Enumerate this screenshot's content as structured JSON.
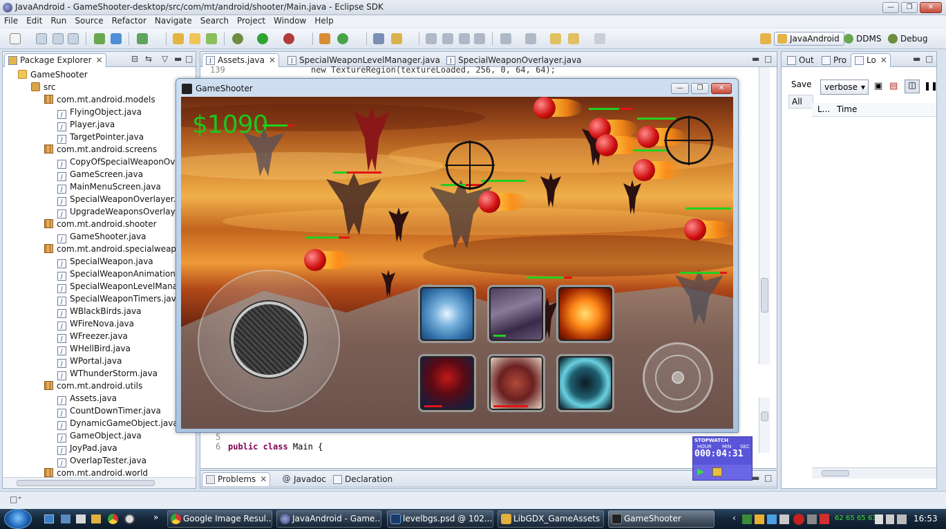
{
  "window": {
    "title": "JavaAndroid - GameShooter-desktop/src/com/mt/android/shooter/Main.java - Eclipse SDK",
    "minimize": "—",
    "maximize": "❐",
    "close": "✕"
  },
  "menu": [
    "File",
    "Edit",
    "Run",
    "Source",
    "Refactor",
    "Navigate",
    "Search",
    "Project",
    "Window",
    "Help"
  ],
  "perspectives": [
    "JavaAndroid",
    "DDMS",
    "Debug"
  ],
  "package_explorer": {
    "tab": "Package Explorer",
    "rows": [
      {
        "label": "GameShooter",
        "kind": "proj",
        "indent": 0
      },
      {
        "label": "src",
        "kind": "src",
        "indent": 1
      },
      {
        "label": "com.mt.android.models",
        "kind": "pkg",
        "indent": 2
      },
      {
        "label": "FlyingObject.java",
        "kind": "file",
        "indent": 3
      },
      {
        "label": "Player.java",
        "kind": "file",
        "indent": 3
      },
      {
        "label": "TargetPointer.java",
        "kind": "file",
        "indent": 3
      },
      {
        "label": "com.mt.android.screens",
        "kind": "pkg",
        "indent": 2
      },
      {
        "label": "CopyOfSpecialWeaponOver",
        "kind": "file",
        "indent": 3
      },
      {
        "label": "GameScreen.java",
        "kind": "file",
        "indent": 3
      },
      {
        "label": "MainMenuScreen.java",
        "kind": "file",
        "indent": 3
      },
      {
        "label": "SpecialWeaponOverlayer.jav",
        "kind": "file",
        "indent": 3
      },
      {
        "label": "UpgradeWeaponsOverlayer.",
        "kind": "file",
        "indent": 3
      },
      {
        "label": "com.mt.android.shooter",
        "kind": "pkg",
        "indent": 2
      },
      {
        "label": "GameShooter.java",
        "kind": "file",
        "indent": 3
      },
      {
        "label": "com.mt.android.specialweapon",
        "kind": "pkg",
        "indent": 2
      },
      {
        "label": "SpecialWeapon.java",
        "kind": "file",
        "indent": 3
      },
      {
        "label": "SpecialWeaponAnimations.j",
        "kind": "file",
        "indent": 3
      },
      {
        "label": "SpecialWeaponLevelManage",
        "kind": "file",
        "indent": 3
      },
      {
        "label": "SpecialWeaponTimers.java",
        "kind": "file",
        "indent": 3
      },
      {
        "label": "WBlackBirds.java",
        "kind": "file",
        "indent": 3
      },
      {
        "label": "WFireNova.java",
        "kind": "file",
        "indent": 3
      },
      {
        "label": "WFreezer.java",
        "kind": "file",
        "indent": 3
      },
      {
        "label": "WHellBird.java",
        "kind": "file",
        "indent": 3
      },
      {
        "label": "WPortal.java",
        "kind": "file",
        "indent": 3
      },
      {
        "label": "WThunderStorm.java",
        "kind": "file",
        "indent": 3
      },
      {
        "label": "com.mt.android.utils",
        "kind": "pkg",
        "indent": 2
      },
      {
        "label": "Assets.java",
        "kind": "file",
        "indent": 3
      },
      {
        "label": "CountDownTimer.java",
        "kind": "file",
        "indent": 3
      },
      {
        "label": "DynamicGameObject.java",
        "kind": "file",
        "indent": 3
      },
      {
        "label": "GameObject.java",
        "kind": "file",
        "indent": 3
      },
      {
        "label": "JoyPad.java",
        "kind": "file",
        "indent": 3
      },
      {
        "label": "OverlapTester.java",
        "kind": "file",
        "indent": 3
      },
      {
        "label": "com.mt.android.world",
        "kind": "pkg",
        "indent": 2
      }
    ]
  },
  "editor": {
    "tabs": [
      "Assets.java",
      "SpecialWeaponLevelManager.java",
      "SpecialWeaponOverlayer.java"
    ],
    "top_line_no": "139",
    "top_code": "new TextureRegion(textureLoaded, 256, 0, 64, 64);",
    "line5_no": "5",
    "line6_no": "6",
    "line6_kw": "public class",
    "line6_rest": " Main {"
  },
  "right_panel": {
    "tabs": [
      "Out",
      "Pro",
      "Lo"
    ],
    "save_label": "Save",
    "all_label": "All",
    "verbose": "verbose",
    "col_l": "L...",
    "col_time": "Time"
  },
  "bottom_tabs": [
    "Problems",
    "Javadoc",
    "Declaration"
  ],
  "game": {
    "title": "GameShooter",
    "money": "$1090"
  },
  "stopwatch": {
    "title": "STOPWATCH",
    "hour": "HOUR",
    "min": "MIN",
    "sec": "SEC",
    "time": "000:04:31"
  },
  "taskbar": {
    "tasks": [
      "Google Image Resul...",
      "JavaAndroid - Game...",
      "levelbgs.psd @ 102...",
      "LibGDX_GameAssets",
      "GameShooter"
    ],
    "tray_numbers": [
      "62",
      "65",
      "65",
      "63"
    ],
    "clock": "16:53"
  },
  "colors": {
    "money": "#1ec51e",
    "stopwatch_bg": "#5a55d8",
    "health": "#1fd11f",
    "damage": "#e21414"
  }
}
